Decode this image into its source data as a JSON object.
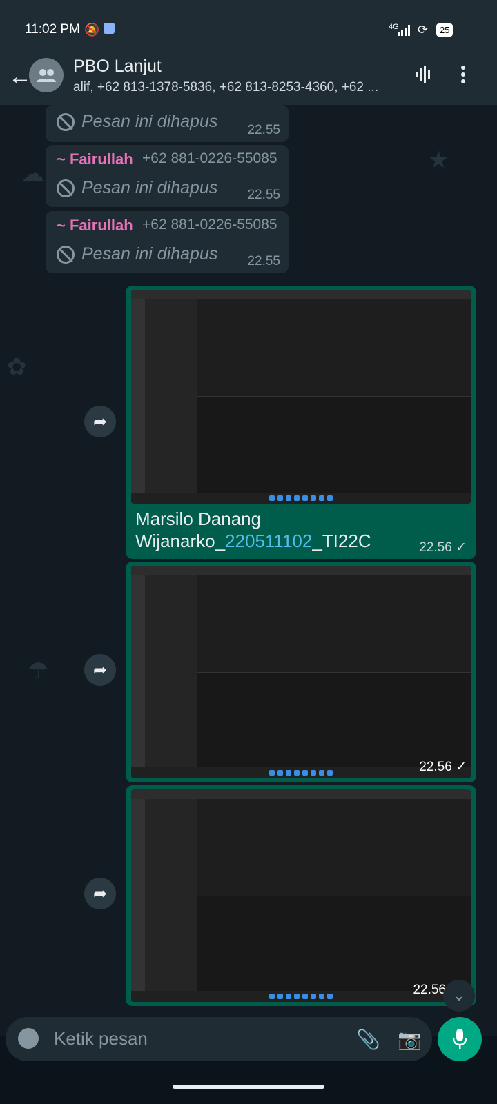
{
  "status_bar": {
    "time": "11:02 PM",
    "network": "4G",
    "battery": "25",
    "icons": [
      "mute-bell-icon",
      "shield-icon",
      "signal-icon",
      "wifi-icon",
      "battery-icon"
    ]
  },
  "header": {
    "title": "PBO Lanjut",
    "subtitle": "alif, +62 813-1378-5836, +62 813-8253-4360, +62 ...",
    "icons": [
      "back-arrow-icon",
      "group-avatar-icon",
      "voice-call-icon",
      "more-icon"
    ]
  },
  "messages": {
    "deleted_1": {
      "text": "Pesan ini dihapus",
      "time": "22.55"
    },
    "deleted_2": {
      "sender": "~ Fairullah",
      "phone": "+62 881-0226-55085",
      "text": "Pesan ini dihapus",
      "time": "22.55"
    },
    "deleted_3": {
      "sender": "~ Fairullah",
      "phone": "+62 881-0226-55085",
      "text": "Pesan ini dihapus",
      "time": "22.55"
    },
    "image_1": {
      "caption_line1": "Marsilo Danang",
      "caption_prefix": "Wijanarko_",
      "caption_link": "220511102",
      "caption_suffix": "_TI22C",
      "time": "22.56 ✓"
    },
    "image_2": {
      "time": "22.56 ✓"
    },
    "image_3": {
      "time": "22.56"
    }
  },
  "composer": {
    "placeholder": "Ketik pesan"
  },
  "colors": {
    "incoming": "#202c33",
    "outgoing": "#005c4b",
    "accent": "#00a884",
    "sender": "#e673b9"
  }
}
